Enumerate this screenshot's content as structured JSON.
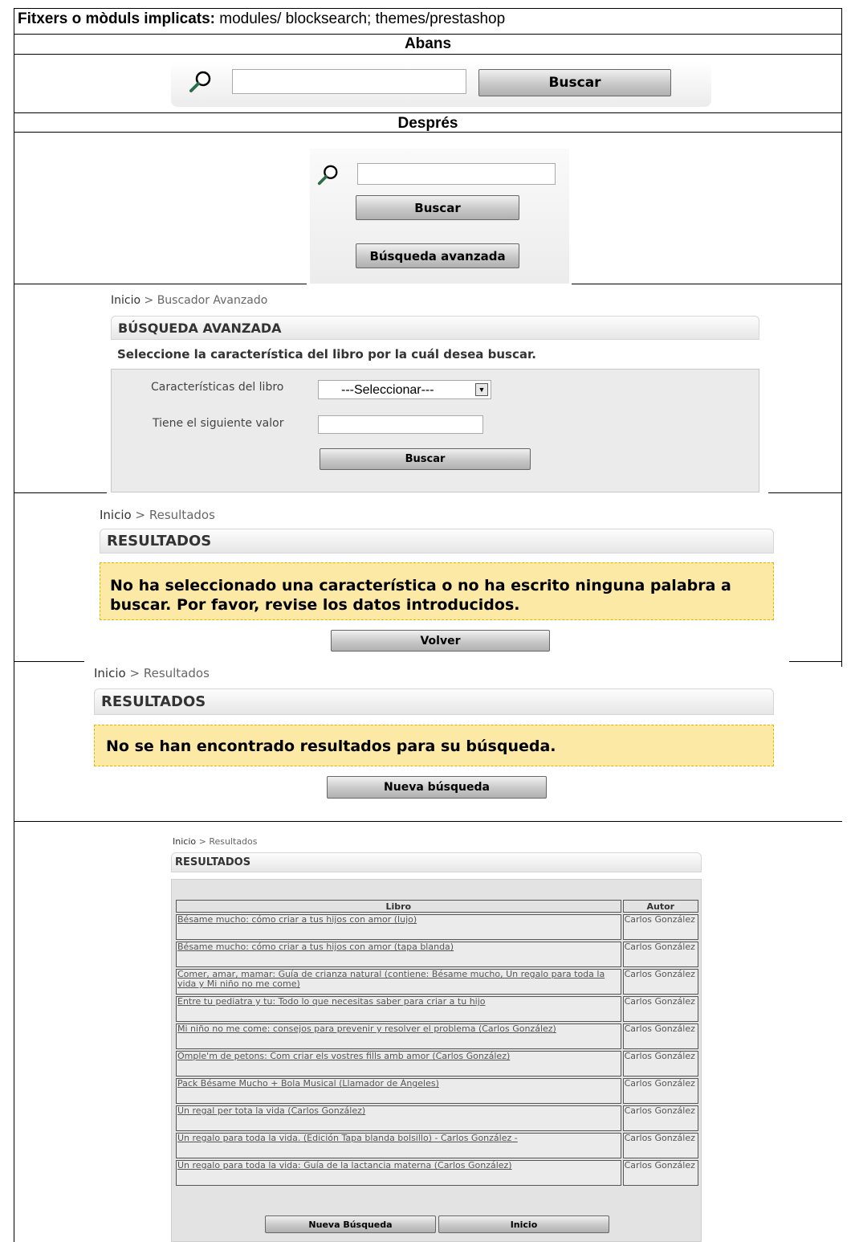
{
  "header": {
    "label": "Fitxers o mòduls implicats:",
    "value": " modules/ blocksearch; themes/prestashop"
  },
  "before": {
    "title": "Abans",
    "search_button": "Buscar"
  },
  "after": {
    "title": "Després",
    "search_button": "Buscar",
    "advanced_button": "Búsqueda avanzada"
  },
  "advanced": {
    "breadcrumb_home": "Inicio",
    "breadcrumb_sep": ">",
    "breadcrumb_current": "Buscador Avanzado",
    "title": "BÚSQUEDA AVANZADA",
    "instruction": "Seleccione la característica del libro por la cuál desea buscar.",
    "feature_label": "Características del libro",
    "feature_select": "---Seleccionar---",
    "value_label": "Tiene el siguiente valor",
    "search_button": "Buscar"
  },
  "results_error": {
    "breadcrumb_home": "Inicio",
    "breadcrumb_sep": ">",
    "breadcrumb_current": "Resultados",
    "title": "RESULTADOS",
    "message_line1": "No ha seleccionado una característica o no ha escrito ninguna palabra a",
    "message_line2": "buscar. Por favor, revise los datos introducidos.",
    "back_button": "Volver"
  },
  "results_empty": {
    "breadcrumb_home": "Inicio",
    "breadcrumb_sep": ">",
    "breadcrumb_current": "Resultados",
    "title": "RESULTADOS",
    "message": "No se han encontrado resultados para su búsqueda.",
    "new_search_button": "Nueva búsqueda"
  },
  "results_list": {
    "breadcrumb_home": "Inicio",
    "breadcrumb_sep": ">",
    "breadcrumb_current": "Resultados",
    "title": "RESULTADOS",
    "col_book": "Libro",
    "col_author": "Autor",
    "rows": [
      {
        "book": "Bésame mucho: cómo criar a tus hijos con amor (lujo)",
        "author": "Carlos González"
      },
      {
        "book": "Bésame mucho: cómo criar a tus hijos con amor (tapa blanda)",
        "author": "Carlos González"
      },
      {
        "book": "Comer, amar, mamar: Guía de crianza natural (contiene: Bésame mucho, Un regalo para toda la vida y Mi niño no me come)",
        "author": "Carlos González"
      },
      {
        "book": "Entre tu pediatra y tu: Todo lo que necesitas saber para criar a tu hijo",
        "author": "Carlos González"
      },
      {
        "book": "Mi niño no me come: consejos para prevenir y resolver el problema (Carlos González)",
        "author": "Carlos González"
      },
      {
        "book": "Omple'm de petons: Com criar els vostres fills amb amor (Carlos González)",
        "author": "Carlos González"
      },
      {
        "book": "Pack Bésame Mucho + Bola Musical (Llamador de Ángeles)",
        "author": "Carlos González"
      },
      {
        "book": "Un regal per tota la vida (Carlos González)",
        "author": "Carlos González"
      },
      {
        "book": "Un regalo para toda la vida. (Edición Tapa blanda bolsillo) - Carlos González -",
        "author": "Carlos González"
      },
      {
        "book": "Un regalo para toda la vida: Guía de la lactancia materna (Carlos González)",
        "author": "Carlos González"
      }
    ],
    "new_search_button": "Nueva Búsqueda",
    "home_button": "Inicio"
  }
}
